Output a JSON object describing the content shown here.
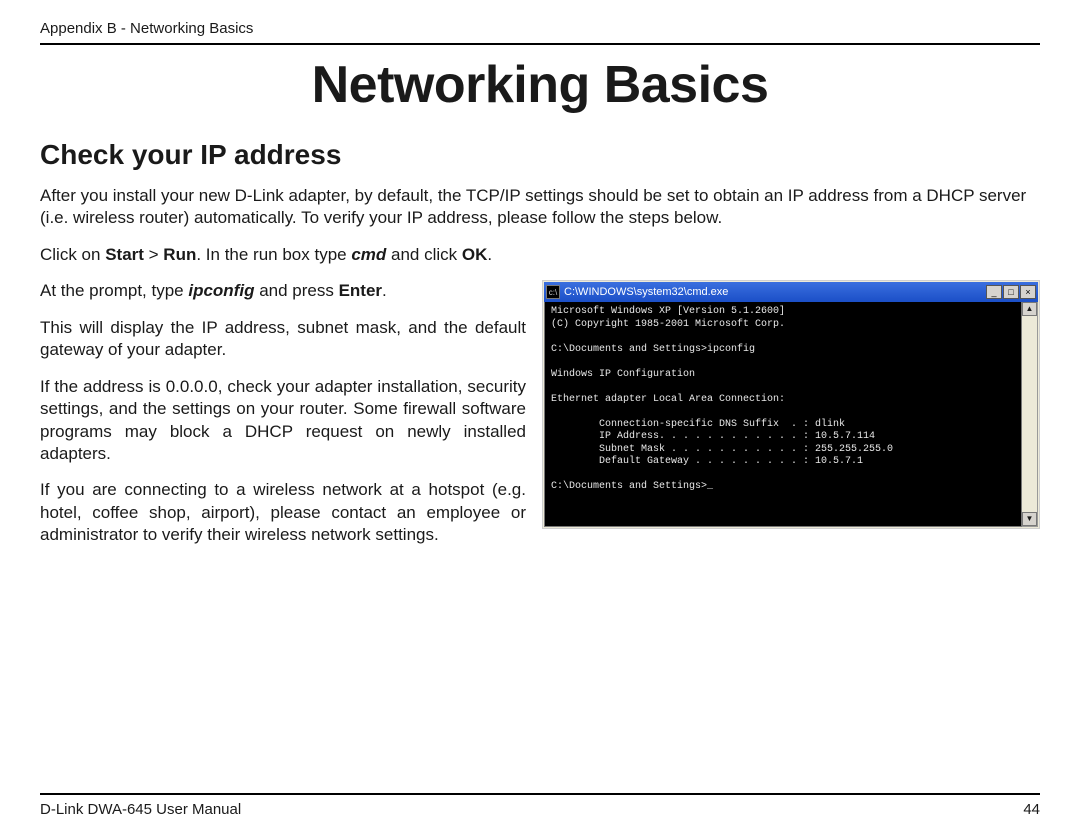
{
  "header": {
    "appendix": "Appendix B - Networking Basics"
  },
  "title": "Networking Basics",
  "subtitle": "Check your IP address",
  "para": {
    "intro": "After you install your new D-Link adapter, by default, the TCP/IP settings should be set to obtain an IP address from a DHCP server (i.e. wireless router) automatically. To verify your IP address, please follow the steps below.",
    "step1_a": "Click on ",
    "step1_start": "Start",
    "step1_gt": " > ",
    "step1_run": "Run",
    "step1_b": ". In the run box type ",
    "step1_cmd": "cmd",
    "step1_c": " and click ",
    "step1_ok": "OK",
    "step1_d": ".",
    "step2_a": "At the prompt, type ",
    "step2_ipconfig": "ipconfig",
    "step2_b": " and press ",
    "step2_enter": "Enter",
    "step2_c": ".",
    "step3": "This will display the IP address, subnet mask, and the default gateway of your adapter.",
    "step4": "If the address is 0.0.0.0, check your adapter installation, security settings, and the settings on your router. Some firewall software programs may block a DHCP request on newly installed adapters.",
    "step5": "If you are connecting to a wireless network at a hotspot (e.g. hotel, coffee shop, airport), please contact an employee or administrator to verify their wireless network settings."
  },
  "cmd": {
    "title": "C:\\WINDOWS\\system32\\cmd.exe",
    "icon_glyph": "c:\\",
    "btn_min": "_",
    "btn_max": "□",
    "btn_close": "×",
    "scroll_up": "▲",
    "scroll_down": "▼",
    "terminal": "Microsoft Windows XP [Version 5.1.2600]\n(C) Copyright 1985-2001 Microsoft Corp.\n\nC:\\Documents and Settings>ipconfig\n\nWindows IP Configuration\n\nEthernet adapter Local Area Connection:\n\n        Connection-specific DNS Suffix  . : dlink\n        IP Address. . . . . . . . . . . . : 10.5.7.114\n        Subnet Mask . . . . . . . . . . . : 255.255.255.0\n        Default Gateway . . . . . . . . . : 10.5.7.1\n\nC:\\Documents and Settings>_"
  },
  "footer": {
    "manual": "D-Link DWA-645 User Manual",
    "page": "44"
  }
}
